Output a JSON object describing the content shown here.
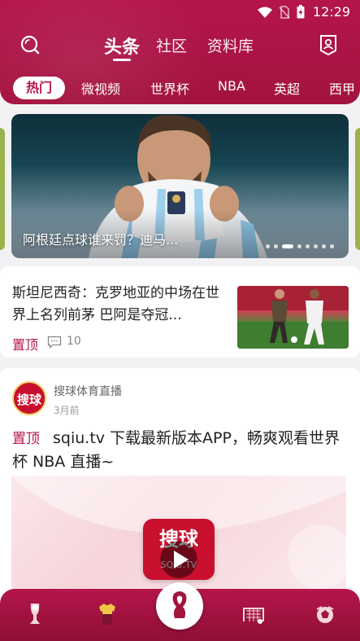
{
  "status_bar": {
    "time": "12:29",
    "icons": [
      "wifi-icon",
      "no-sim-icon",
      "battery-charging-icon"
    ]
  },
  "header": {
    "tabs": [
      {
        "label": "头条",
        "active": true
      },
      {
        "label": "社区",
        "active": false
      },
      {
        "label": "资料库",
        "active": false
      }
    ],
    "left_icon": "search-icon",
    "right_icon": "profile-icon"
  },
  "categories": [
    {
      "label": "热门",
      "active": true
    },
    {
      "label": "微视频",
      "active": false
    },
    {
      "label": "世界杯",
      "active": false
    },
    {
      "label": "NBA",
      "active": false
    },
    {
      "label": "英超",
      "active": false
    },
    {
      "label": "西甲",
      "active": false
    }
  ],
  "banner": {
    "caption": "阿根廷点球谁来罚？迪马...",
    "dot_count": 8,
    "active_dot": 2
  },
  "news": [
    {
      "title": "斯坦尼西奇：克罗地亚的中场在世界上名列前茅 巴阿是夺冠...",
      "pin_label": "置顶",
      "comment_count": "10"
    }
  ],
  "post": {
    "avatar_text": "搜球",
    "author": "搜球体育直播",
    "time": "3月前",
    "pin_label": "置顶",
    "text": "sqiu.tv 下载最新版本APP，畅爽观看世界杯 NBA 直播~",
    "logo_text": "搜球",
    "logo_sub": "SQIU.TV"
  },
  "bottom_nav": [
    {
      "icon": "trophy-icon"
    },
    {
      "icon": "jersey-icon"
    },
    {
      "icon": "world-cup-emblem-icon"
    },
    {
      "icon": "goal-net-icon"
    },
    {
      "icon": "ball-icon"
    }
  ],
  "colors": {
    "brand": "#b5154b",
    "pin": "#b5154b"
  }
}
